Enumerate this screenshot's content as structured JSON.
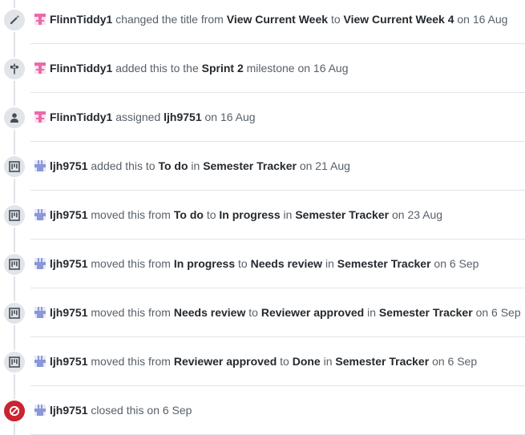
{
  "colors": {
    "badge_bg": "#e1e4e8",
    "badge_closed": "#cb2431",
    "avatar_flinn": "#e96ba8",
    "avatar_ljh": "#8a97d9"
  },
  "events": [
    {
      "icon": "pencil-icon",
      "actor": "FlinnTiddy1",
      "parts": [
        "changed the title from",
        "View Current Week",
        "to",
        "View Current Week 4",
        "on 16 Aug"
      ]
    },
    {
      "icon": "milestone-icon",
      "actor": "FlinnTiddy1",
      "parts": [
        "added this to the",
        "Sprint 2",
        "milestone on 16 Aug"
      ]
    },
    {
      "icon": "person-icon",
      "actor": "FlinnTiddy1",
      "parts": [
        "assigned",
        "ljh9751",
        "on 16 Aug"
      ]
    },
    {
      "icon": "project-icon",
      "actor": "ljh9751",
      "parts": [
        "added this to",
        "To do",
        "in",
        "Semester Tracker",
        "on 21 Aug"
      ]
    },
    {
      "icon": "project-icon",
      "actor": "ljh9751",
      "parts": [
        "moved this from",
        "To do",
        "to",
        "In progress",
        "in",
        "Semester Tracker",
        "on 23 Aug"
      ]
    },
    {
      "icon": "project-icon",
      "actor": "ljh9751",
      "parts": [
        "moved this from",
        "In progress",
        "to",
        "Needs review",
        "in",
        "Semester Tracker",
        "on 6 Sep"
      ]
    },
    {
      "icon": "project-icon",
      "actor": "ljh9751",
      "parts": [
        "moved this from",
        "Needs review",
        "to",
        "Reviewer approved",
        "in",
        "Semester Tracker",
        "on 6 Sep"
      ]
    },
    {
      "icon": "project-icon",
      "actor": "ljh9751",
      "parts": [
        "moved this from",
        "Reviewer approved",
        "to",
        "Done",
        "in",
        "Semester Tracker",
        "on 6 Sep"
      ]
    },
    {
      "icon": "circle-slash-icon",
      "actor": "ljh9751",
      "parts": [
        "closed this on 6 Sep"
      ]
    }
  ]
}
